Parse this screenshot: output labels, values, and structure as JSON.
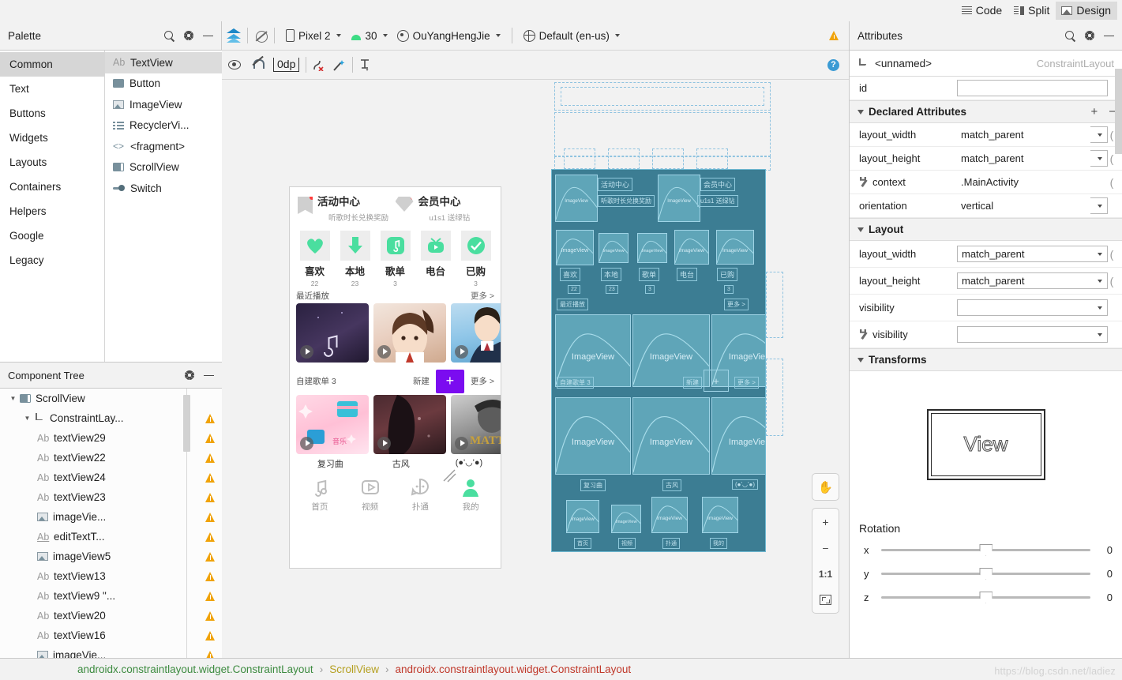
{
  "editor_tabs": [
    {
      "label": "Code",
      "icon": "code-lines-icon",
      "active": false
    },
    {
      "label": "Split",
      "icon": "split-icon",
      "active": false
    },
    {
      "label": "Design",
      "icon": "design-image-icon",
      "active": true
    }
  ],
  "palette": {
    "title": "Palette",
    "icons": [
      "search-icon",
      "gear-icon",
      "minimize-icon"
    ],
    "categories": [
      {
        "label": "Common",
        "selected": true
      },
      {
        "label": "Text",
        "selected": false
      },
      {
        "label": "Buttons",
        "selected": false
      },
      {
        "label": "Widgets",
        "selected": false
      },
      {
        "label": "Layouts",
        "selected": false
      },
      {
        "label": "Containers",
        "selected": false
      },
      {
        "label": "Helpers",
        "selected": false
      },
      {
        "label": "Google",
        "selected": false
      },
      {
        "label": "Legacy",
        "selected": false
      }
    ],
    "items": [
      {
        "label": "TextView",
        "icon": "textview-icon",
        "selected": true
      },
      {
        "label": "Button",
        "icon": "button-icon",
        "selected": false
      },
      {
        "label": "ImageView",
        "icon": "imageview-icon",
        "selected": false
      },
      {
        "label": "RecyclerVi...",
        "icon": "recyclerview-icon",
        "selected": false
      },
      {
        "label": "<fragment>",
        "icon": "fragment-icon",
        "selected": false
      },
      {
        "label": "ScrollView",
        "icon": "scrollview-icon",
        "selected": false
      },
      {
        "label": "Switch",
        "icon": "switch-icon",
        "selected": false
      }
    ]
  },
  "component_tree": {
    "title": "Component Tree",
    "icons": [
      "gear-icon",
      "minimize-icon"
    ],
    "nodes": [
      {
        "label": "ScrollView",
        "indent": 0,
        "twisty": "▼",
        "icon": "scrollview-icon",
        "warn": false
      },
      {
        "label": "ConstraintLay...",
        "indent": 1,
        "twisty": "▼",
        "icon": "constraintlayout-icon",
        "warn": true
      },
      {
        "label": "textView29",
        "indent": 2,
        "twisty": "",
        "icon": "textview-icon",
        "warn": true
      },
      {
        "label": "textView22",
        "indent": 2,
        "twisty": "",
        "icon": "textview-icon",
        "warn": true
      },
      {
        "label": "textView24",
        "indent": 2,
        "twisty": "",
        "icon": "textview-icon",
        "warn": true
      },
      {
        "label": "textView23",
        "indent": 2,
        "twisty": "",
        "icon": "textview-icon",
        "warn": true
      },
      {
        "label": "imageVie...",
        "indent": 2,
        "twisty": "",
        "icon": "imageview-icon",
        "warn": true
      },
      {
        "label": "editTextT...",
        "indent": 2,
        "twisty": "",
        "icon": "edittext-icon",
        "warn": true
      },
      {
        "label": "imageView5",
        "indent": 2,
        "twisty": "",
        "icon": "imageview-icon",
        "warn": true
      },
      {
        "label": "textView13",
        "indent": 2,
        "twisty": "",
        "icon": "textview-icon",
        "warn": true
      },
      {
        "label": "textView9  \"...",
        "indent": 2,
        "twisty": "",
        "icon": "textview-icon",
        "warn": true
      },
      {
        "label": "textView20",
        "indent": 2,
        "twisty": "",
        "icon": "textview-icon",
        "warn": true
      },
      {
        "label": "textView16",
        "indent": 2,
        "twisty": "",
        "icon": "textview-icon",
        "warn": true
      },
      {
        "label": "imageVie...",
        "indent": 2,
        "twisty": "",
        "icon": "imageview-icon",
        "warn": true
      }
    ]
  },
  "design_toolbar": {
    "device": "Pixel 2",
    "api": "30",
    "theme": "OuYangHengJie",
    "locale": "Default (en-us)",
    "icons": [
      "layers-icon",
      "no-blueprint-icon",
      "phone-icon",
      "android-icon",
      "theme-icon",
      "globe-icon",
      "warning-icon"
    ]
  },
  "constraint_toolbar": {
    "margin": "0dp",
    "icons": [
      "eye-icon",
      "magnet-icon",
      "clear-constraints-icon",
      "infer-constraints-icon",
      "align-icon",
      "help-icon"
    ]
  },
  "preview": {
    "header_left": {
      "title": "活动中心",
      "subtitle": "听歌时长兑换奖励",
      "icon": "bookmark-icon"
    },
    "header_right": {
      "title": "会员中心",
      "subtitle": "u1s1 送绿钻",
      "icon": "diamond-icon"
    },
    "quick_actions": [
      {
        "label": "喜欢",
        "count": "22",
        "icon": "heart-icon"
      },
      {
        "label": "本地",
        "count": "23",
        "icon": "download-icon"
      },
      {
        "label": "歌单",
        "count": "3",
        "icon": "music-note-icon"
      },
      {
        "label": "电台",
        "count": "",
        "icon": "radio-icon"
      },
      {
        "label": "已购",
        "count": "3",
        "icon": "check-icon"
      }
    ],
    "section1": {
      "title": "最近播放",
      "more": "更多 >"
    },
    "row1": [
      {
        "caption": "自建歌单 3"
      },
      {
        "caption": ""
      },
      {
        "caption": ""
      }
    ],
    "section2": {
      "title": "自建歌单 3",
      "new_label": "新建",
      "plus": "+",
      "more": "更多 >"
    },
    "row2_captions": [
      "复习曲",
      "古风",
      "(●'◡'●)"
    ],
    "tabbar": [
      {
        "label": "首页",
        "icon": "music-note-icon",
        "active": true
      },
      {
        "label": "视频",
        "icon": "video-icon",
        "active": false
      },
      {
        "label": "扑通",
        "icon": "chat-icon",
        "active": false
      },
      {
        "label": "我的",
        "icon": "person-icon",
        "active": true
      }
    ]
  },
  "blueprint": {
    "imageview_label": "ImageView",
    "texts": {
      "h1": "活动中心",
      "h1sub": "听歌时长兑换奖励",
      "h2": "会员中心",
      "h2sub": "u1s1 送绿钻",
      "q": [
        "喜欢",
        "本地",
        "歌单",
        "电台",
        "已购"
      ],
      "qn": [
        "22",
        "23",
        "3",
        "",
        "3"
      ],
      "recent": "最近播放",
      "more": "更多 >",
      "mylist": "自建歌单 3",
      "new": "新建",
      "plus": "+",
      "more2": "更多 >",
      "caps": [
        "复习曲",
        "古风",
        "(●'◡'●)"
      ],
      "tabs": [
        "首页",
        "视频",
        "扑通",
        "我的"
      ]
    }
  },
  "zoom_controls": [
    {
      "label": "✋",
      "name": "pan-tool"
    },
    {
      "label": "+",
      "name": "zoom-in"
    },
    {
      "label": "−",
      "name": "zoom-out"
    },
    {
      "label": "1:1",
      "name": "zoom-actual"
    },
    {
      "label": "",
      "name": "zoom-to-fit"
    }
  ],
  "attributes": {
    "title": "Attributes",
    "icons": [
      "search-icon",
      "gear-icon",
      "minimize-icon"
    ],
    "selected_name": "<unnamed>",
    "selected_type": "ConstraintLayout",
    "id_label": "id",
    "id_value": "",
    "declared": {
      "title": "Declared Attributes",
      "add": "+",
      "remove": "−",
      "rows": [
        {
          "key": "layout_width",
          "value": "match_parent",
          "dropdown": true,
          "wrench": false
        },
        {
          "key": "layout_height",
          "value": "match_parent",
          "dropdown": true,
          "wrench": false
        },
        {
          "key": "context",
          "value": ".MainActivity",
          "dropdown": false,
          "wrench": true
        },
        {
          "key": "orientation",
          "value": "vertical",
          "dropdown": true,
          "wrench": false
        }
      ]
    },
    "layout": {
      "title": "Layout",
      "rows": [
        {
          "key": "layout_width",
          "value": "match_parent",
          "dropdown": true,
          "wrench": false,
          "boxed": true
        },
        {
          "key": "layout_height",
          "value": "match_parent",
          "dropdown": true,
          "wrench": false,
          "boxed": true
        },
        {
          "key": "visibility",
          "value": "",
          "dropdown": true,
          "wrench": false,
          "boxed": true
        },
        {
          "key": "visibility",
          "value": "",
          "dropdown": true,
          "wrench": true,
          "boxed": true
        }
      ]
    },
    "transforms": {
      "title": "Transforms",
      "view_label": "View",
      "rotation_label": "Rotation",
      "sliders": [
        {
          "axis": "x",
          "value": "0"
        },
        {
          "axis": "y",
          "value": "0"
        },
        {
          "axis": "z",
          "value": "0"
        }
      ]
    }
  },
  "breadcrumb": [
    {
      "text": "androidx.constraintlayout.widget.ConstraintLayout",
      "color": "green"
    },
    {
      "text": "›",
      "color": "sep"
    },
    {
      "text": "ScrollView",
      "color": "yellow"
    },
    {
      "text": "›",
      "color": "sep"
    },
    {
      "text": "androidx.constraintlayout.widget.ConstraintLayout",
      "color": "red"
    }
  ],
  "watermark": "https://blog.csdn.net/ladiez"
}
